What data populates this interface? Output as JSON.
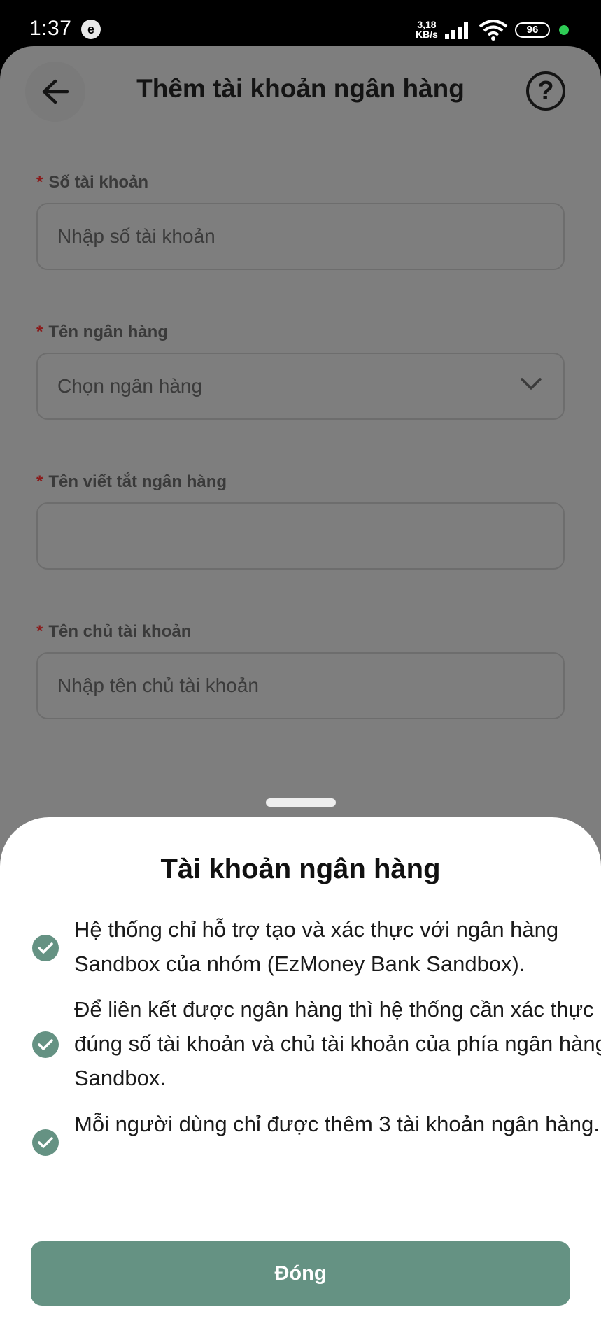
{
  "status_bar": {
    "time": "1:37",
    "notif_glyph": "e",
    "net_speed_value": "3,18",
    "net_speed_unit": "KB/s",
    "battery": "96",
    "dot_color": "#2ecc55"
  },
  "header": {
    "title": "Thêm tài khoản ngân hàng",
    "back_icon": "arrow-left-icon",
    "help_icon": "?"
  },
  "form": {
    "account_number": {
      "label": "Số tài khoản",
      "required": "*",
      "placeholder": "Nhập số tài khoản"
    },
    "bank_name": {
      "label": "Tên ngân hàng",
      "required": "*",
      "placeholder": "Chọn ngân hàng"
    },
    "bank_short_name": {
      "label": "Tên viết tắt ngân hàng",
      "required": "*",
      "value": ""
    },
    "account_holder": {
      "label": "Tên chủ tài khoản",
      "required": "*",
      "placeholder": "Nhập tên chủ tài khoản"
    }
  },
  "sheet": {
    "title": "Tài khoản ngân hàng",
    "items": [
      {
        "text": "Hệ thống chỉ hỗ trợ tạo và xác thực với ngân hàng Sandbox của nhóm (EzMoney Bank Sandbox)."
      },
      {
        "text": "Để liên kết được ngân hàng thì hệ thống cần xác thực đúng số tài khoản và chủ tài khoản của phía ngân hàng Sandbox."
      },
      {
        "text": "Mỗi người dùng chỉ được thêm 3 tài khoản ngân hàng."
      }
    ],
    "close_label": "Đóng"
  },
  "colors": {
    "accent": "#659283",
    "overlay_bg": "#7e7e7e",
    "required": "#8a1a1a"
  }
}
